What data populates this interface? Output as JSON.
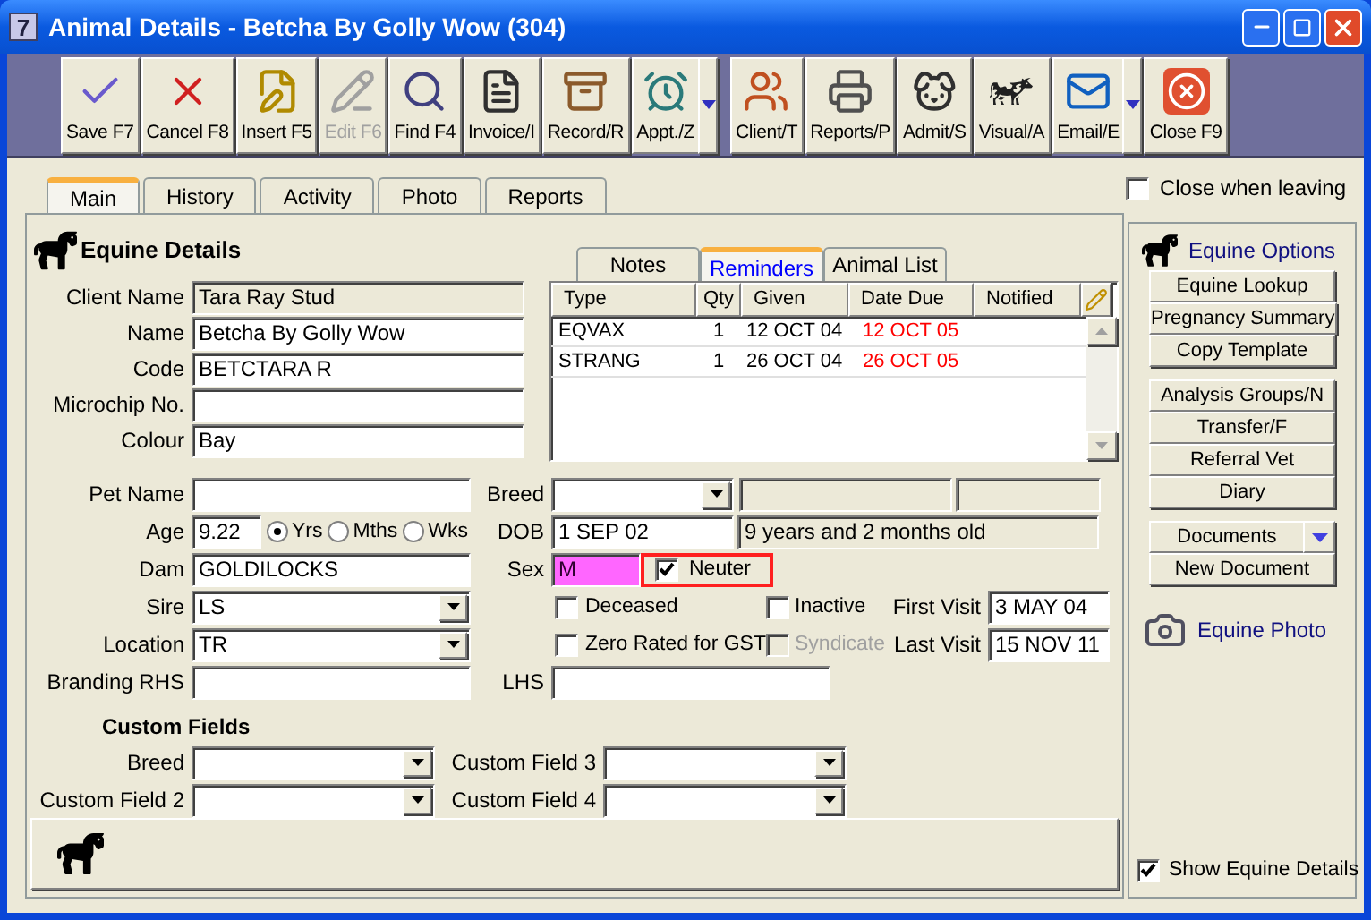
{
  "window": {
    "title": "Animal Details - Betcha By Golly Wow (304)",
    "app_icon": "7"
  },
  "toolbar": [
    {
      "label": "Save F7",
      "disabled": false,
      "dropdown": false
    },
    {
      "label": "Cancel F8",
      "disabled": false,
      "dropdown": false
    },
    {
      "label": "Insert F5",
      "disabled": false,
      "dropdown": false
    },
    {
      "label": "Edit F6",
      "disabled": true,
      "dropdown": false
    },
    {
      "label": "Find F4",
      "disabled": false,
      "dropdown": false
    },
    {
      "label": "Invoice/I",
      "disabled": false,
      "dropdown": false
    },
    {
      "label": "Record/R",
      "disabled": false,
      "dropdown": false
    },
    {
      "label": "Appt./Z",
      "disabled": false,
      "dropdown": true
    },
    {
      "label": "Client/T",
      "disabled": false,
      "dropdown": false
    },
    {
      "label": "Reports/P",
      "disabled": false,
      "dropdown": false
    },
    {
      "label": "Admit/S",
      "disabled": false,
      "dropdown": false
    },
    {
      "label": "Visual/A",
      "disabled": false,
      "dropdown": false
    },
    {
      "label": "Email/E",
      "disabled": false,
      "dropdown": true
    },
    {
      "label": "Close F9",
      "disabled": false,
      "dropdown": false
    }
  ],
  "tabs": [
    {
      "label": "Main",
      "selected": true
    },
    {
      "label": "History",
      "selected": false
    },
    {
      "label": "Activity",
      "selected": false
    },
    {
      "label": "Photo",
      "selected": false
    },
    {
      "label": "Reports",
      "selected": false
    }
  ],
  "close_when_leaving": {
    "label": "Close when leaving",
    "checked": false
  },
  "equine_details": {
    "title": "Equine Details",
    "fields": [
      {
        "label": "Client Name",
        "value": "Tara Ray Stud",
        "readonly": true
      },
      {
        "label": "Name",
        "value": "Betcha By Golly Wow",
        "readonly": false
      },
      {
        "label": "Code",
        "value": "BETCTARA R",
        "readonly": false
      },
      {
        "label": "Microchip No.",
        "readonly": false
      },
      {
        "label": "Colour",
        "value": "Bay",
        "readonly": false
      }
    ]
  },
  "reminders": {
    "tabs": [
      {
        "label": "Notes",
        "selected": false
      },
      {
        "label": "Reminders",
        "selected": true
      },
      {
        "label": "Animal List",
        "selected": false
      }
    ],
    "columns": [
      "Type",
      "Qty",
      "Given",
      "Date Due",
      "Notified"
    ],
    "rows": [
      {
        "type": "EQVAX",
        "qty": "1",
        "given": "12 OCT 04",
        "date_due": "12 OCT 05",
        "overdue": true
      },
      {
        "type": "STRANG",
        "qty": "1",
        "given": "26 OCT 04",
        "date_due": "26 OCT 05",
        "overdue": true
      }
    ]
  },
  "details": {
    "pet_name": {
      "label": "Pet Name"
    },
    "breed": {
      "label": "Breed"
    },
    "age": {
      "label": "Age",
      "value": "9.22",
      "units": [
        {
          "label": "Yrs",
          "selected": true
        },
        {
          "label": "Mths",
          "selected": false
        },
        {
          "label": "Wks",
          "selected": false
        }
      ]
    },
    "dob": {
      "label": "DOB",
      "value": "1 SEP 02",
      "age_text": "9 years and 2 months old"
    },
    "dam": {
      "label": "Dam",
      "value": "GOLDILOCKS"
    },
    "sex": {
      "label": "Sex",
      "value": "M"
    },
    "neuter": {
      "label": "Neuter",
      "checked": true,
      "highlighted": true
    },
    "sire": {
      "label": "Sire",
      "value": "LS"
    },
    "location": {
      "label": "Location",
      "value": "TR"
    },
    "checks": [
      {
        "label": "Deceased",
        "checked": false,
        "disabled": false
      },
      {
        "label": "Inactive",
        "checked": false,
        "disabled": false
      },
      {
        "label": "Zero Rated for GST",
        "checked": false,
        "disabled": false
      },
      {
        "label": "Syndicate",
        "checked": false,
        "disabled": true
      }
    ],
    "first_visit": {
      "label": "First Visit",
      "value": "3 MAY 04"
    },
    "last_visit": {
      "label": "Last Visit",
      "value": "15 NOV 11"
    },
    "branding_rhs": {
      "label": "Branding RHS"
    },
    "lhs": {
      "label": "LHS"
    }
  },
  "custom_fields": {
    "title": "Custom Fields",
    "fields": [
      {
        "label": "Breed"
      },
      {
        "label": "Custom Field 3"
      },
      {
        "label": "Custom Field 2"
      },
      {
        "label": "Custom Field 4"
      }
    ]
  },
  "options": {
    "title": "Equine Options",
    "groups": [
      [
        {
          "label": "Equine Lookup",
          "dropdown": false
        },
        {
          "label": "Pregnancy Summary",
          "dropdown": false
        },
        {
          "label": "Copy Template",
          "dropdown": false
        }
      ],
      [
        {
          "label": "Analysis Groups/N",
          "dropdown": false
        },
        {
          "label": "Transfer/F",
          "dropdown": false
        },
        {
          "label": "Referral Vet",
          "dropdown": false
        },
        {
          "label": "Diary",
          "dropdown": false
        }
      ],
      [
        {
          "label": "Documents",
          "dropdown": true
        },
        {
          "label": "New Document",
          "dropdown": false
        }
      ]
    ],
    "photo_link": "Equine Photo",
    "show_details": {
      "label": "Show Equine Details",
      "checked": true
    }
  }
}
